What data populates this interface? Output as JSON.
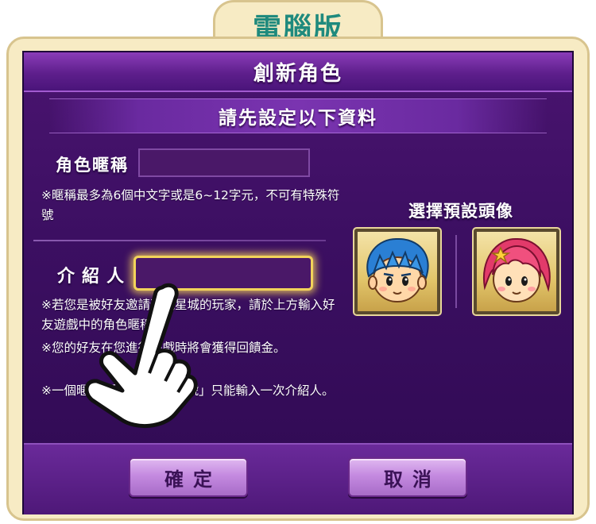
{
  "tab": {
    "title": "電腦版"
  },
  "dialog": {
    "title": "創新角色",
    "subtitle": "請先設定以下資料"
  },
  "form": {
    "nickname": {
      "label": "角色暱稱",
      "value": "",
      "placeholder": ""
    },
    "nickname_note": "※暱稱最多為6個中文字或是6~12字元，不可有特殊符號",
    "referrer": {
      "label": "介紹人",
      "value": "",
      "placeholder": ""
    },
    "referrer_notes": [
      "※若您是被好友邀請遊玩星城的玩家，請於上方輸入好友遊戲中的角色暱稱。",
      "※您的好友在您進行遊戲時將會獲得回饋金。",
      "※一個暱稱/手機門號/FB帳號」只能輸入一次介紹人。"
    ]
  },
  "avatar": {
    "title": "選擇預設頭像",
    "options": [
      {
        "name": "boy",
        "hair_color": "#2a7fd4"
      },
      {
        "name": "girl",
        "hair_color": "#e23a6a"
      }
    ]
  },
  "buttons": {
    "confirm": "確定",
    "cancel": "取消"
  },
  "colors": {
    "frame": "#f7ebc4",
    "panel": "#3c0f62",
    "accent_tab_text": "#1f8a7d",
    "highlight": "#f2d35a",
    "button": "#c48ae0"
  }
}
